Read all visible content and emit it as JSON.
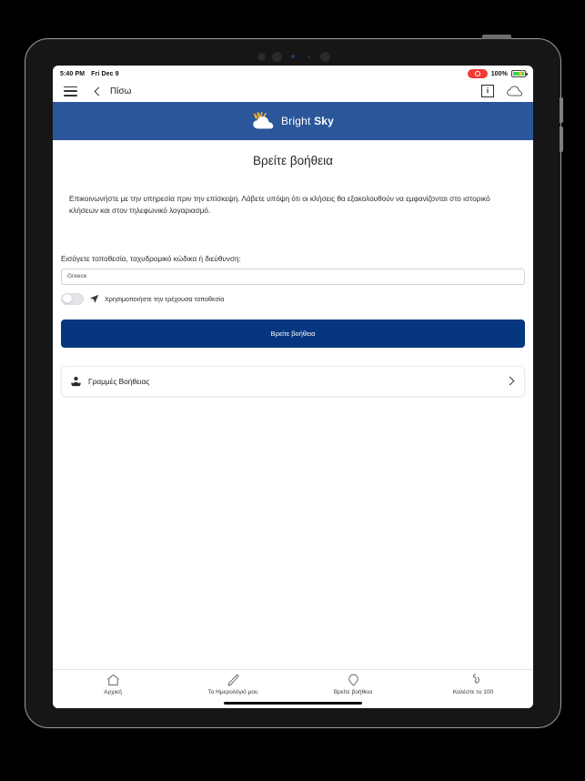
{
  "status_bar": {
    "time": "5:40 PM",
    "date": "Fri Dec 9",
    "battery_percent": "100%",
    "recording_icon": "screen-recording-indicator",
    "battery_icon": "battery-charging-icon"
  },
  "nav_bar": {
    "menu_icon": "hamburger-menu-icon",
    "back_icon": "chevron-left-icon",
    "back_label": "Πίσω",
    "info_icon": "info-icon",
    "cloud_icon": "cloud-icon"
  },
  "app_header": {
    "logo_icon": "bright-sky-cloud-sun-logo",
    "brand_first": "Bright",
    "brand_second": "Sky",
    "background_color": "#2b5699"
  },
  "main": {
    "title": "Βρείτε βοήθεια",
    "intro": "Επικοινωνήστε με την υπηρεσία πριν την επίσκεψη. Λάβετε υπόψη ότι οι κλήσεις θα εξακολουθούν να εμφανίζονται στο ιστορικό κλήσεων και στον τηλεφωνικό λογαριασμό.",
    "field_label": "Εισάγετε τοποθεσία, ταχυδρομικό κώδικα ή διεύθυνση:",
    "location_input_value": "Greece",
    "location_input_placeholder": "Greece",
    "toggle_icon": "navigation-arrow-icon",
    "toggle_label": "Χρησιμοποιήστε την τρέχουσα τοποθεσία",
    "toggle_state": "off",
    "submit_label": "Βρείτε βοήθεια",
    "submit_color": "#06367f",
    "helplines": {
      "icon": "person-headset-icon",
      "label": "Γραμμές Βοήθειας",
      "chevron_icon": "chevron-right-icon"
    }
  },
  "tab_bar": {
    "tabs": [
      {
        "icon": "home-icon",
        "label": "Αρχική",
        "active": false
      },
      {
        "icon": "pencil-icon",
        "label": "Το Ημερολόγιό μου",
        "active": false
      },
      {
        "icon": "map-pin-icon",
        "label": "Βρείτε βοήθεια",
        "active": true
      },
      {
        "icon": "phone-icon",
        "label": "Καλέστε το 100",
        "active": false
      }
    ]
  }
}
